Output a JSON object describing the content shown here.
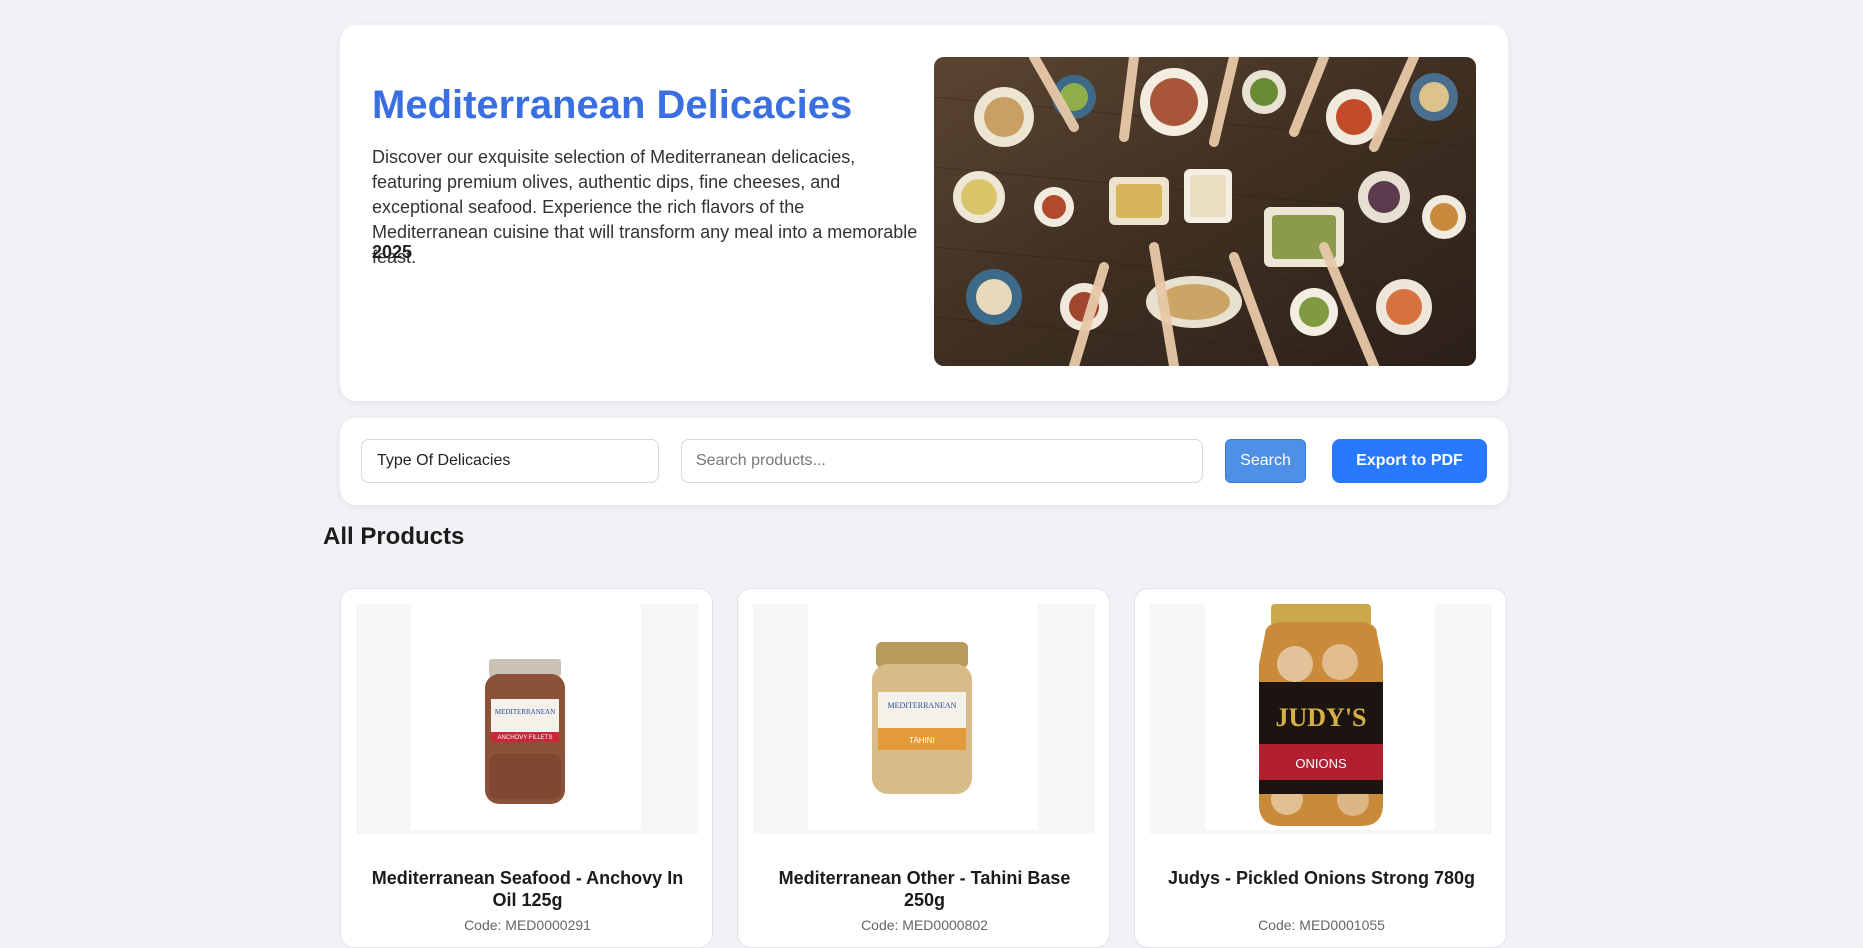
{
  "hero": {
    "title": "Mediterranean Delicacies",
    "description": "Discover our exquisite selection of Mediterranean delicacies, featuring premium olives, authentic dips, fine cheeses, and exceptional seafood. Experience the rich flavors of the Mediterranean cuisine that will transform any meal into a memorable feast.",
    "year": "2025"
  },
  "filters": {
    "type_select": "Type Of Delicacies",
    "search_placeholder": "Search products...",
    "search_button": "Search",
    "export_button": "Export to PDF"
  },
  "section_title": "All Products",
  "products": [
    {
      "name": "Mediterranean Seafood - Anchovy In Oil 125g",
      "code": "Code: MED0000291",
      "jar_label": "ANCHOVY FILLETS",
      "brand": "MEDITERRANEAN"
    },
    {
      "name": "Mediterranean Other - Tahini Base 250g",
      "code": "Code: MED0000802",
      "jar_label": "TAHINI",
      "brand": "MEDITERRANEAN"
    },
    {
      "name": "Judys - Pickled Onions Strong 780g",
      "code": "Code: MED0001055",
      "jar_label": "ONIONS",
      "brand": "JUDY'S"
    }
  ],
  "colors": {
    "accent": "#3a6fe2",
    "export_button": "#2979ff",
    "search_button": "#4f8fe6",
    "background": "#f1f1f6"
  }
}
